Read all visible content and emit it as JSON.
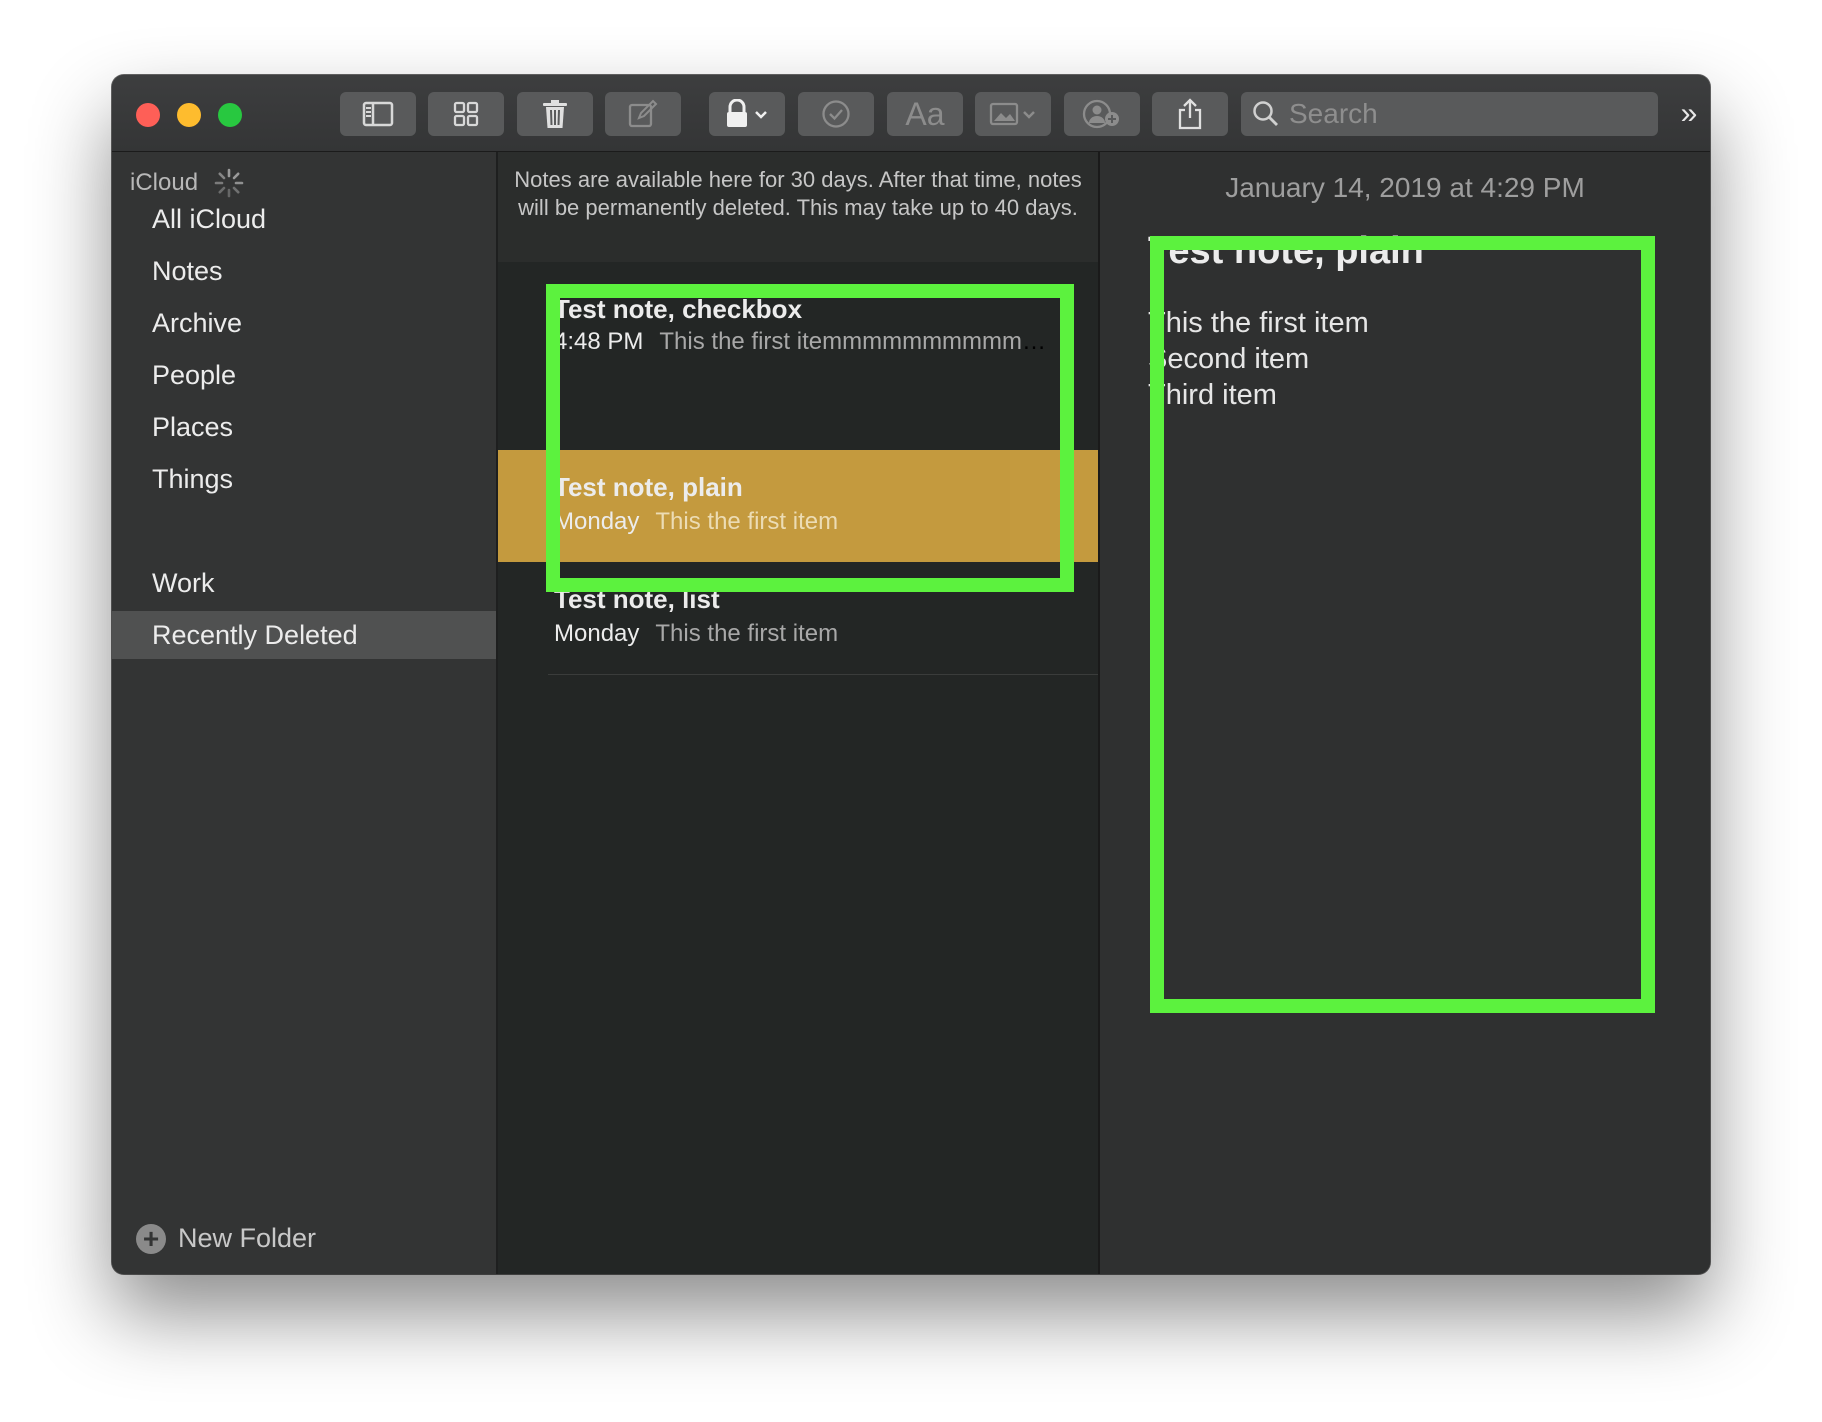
{
  "toolbar": {
    "search_placeholder": "Search",
    "overflow_label": "»",
    "format_label": "Aa"
  },
  "sidebar": {
    "account": "iCloud",
    "items": [
      {
        "label": "All iCloud"
      },
      {
        "label": "Notes"
      },
      {
        "label": "Archive"
      },
      {
        "label": "People"
      },
      {
        "label": "Places"
      },
      {
        "label": "Things"
      },
      {
        "label": "Work"
      },
      {
        "label": "Recently Deleted"
      }
    ],
    "new_folder": "New Folder"
  },
  "list": {
    "info": "Notes are available here for 30 days. After that time, notes will be permanently deleted. This may take up to 40 days.",
    "notes": [
      {
        "title": "Test note, checkbox",
        "date": "4:48 PM",
        "preview": "This the first itemmmmmmmmmmm..."
      },
      {
        "title": "Test note, plain",
        "date": "Monday",
        "preview": "This the first item"
      },
      {
        "title": "Test note, list",
        "date": "Monday",
        "preview": "This the first item"
      }
    ]
  },
  "editor": {
    "date": "January 14, 2019 at 4:29 PM",
    "title": "Test note, plain",
    "lines": [
      "This the first item",
      "Second item",
      "Third item"
    ]
  },
  "colors": {
    "accent_selected": "#c49a3e",
    "annotation": "#5cf23e"
  }
}
